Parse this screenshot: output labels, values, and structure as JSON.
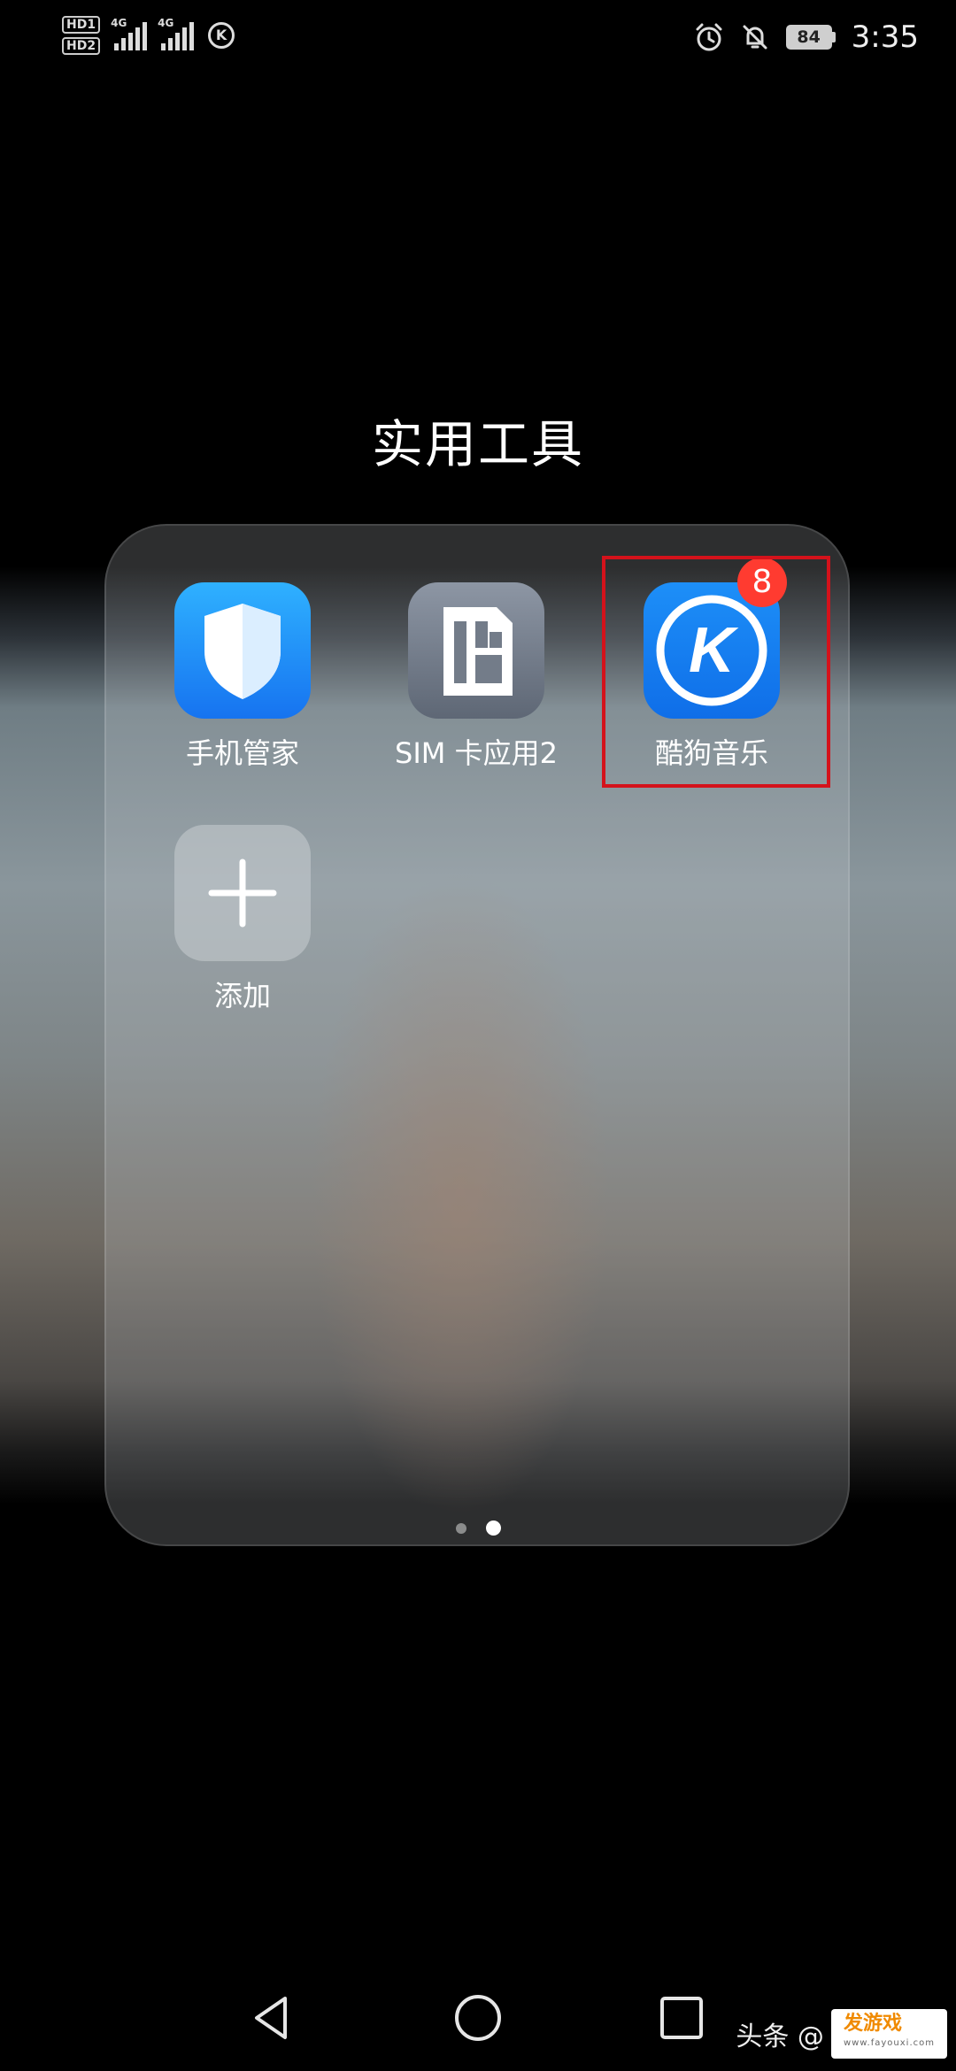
{
  "status_bar": {
    "sim1_label": "HD1",
    "sim2_label": "HD2",
    "network1": "4G",
    "network2": "4G",
    "kugou_status_icon": "K",
    "battery_level": "84",
    "time": "3:35"
  },
  "folder": {
    "title": "实用工具",
    "apps": [
      {
        "label": "手机管家",
        "icon": "shield-icon"
      },
      {
        "label": "SIM 卡应用2",
        "icon": "sim-card-icon"
      },
      {
        "label": "酷狗音乐",
        "icon": "kugou-icon",
        "badge": "8"
      }
    ],
    "add": {
      "label": "添加",
      "icon": "plus-icon"
    },
    "pages": 2,
    "current_page": 2
  },
  "watermark": {
    "text": "头条 @",
    "logo_main": "发游戏",
    "logo_sub": "www.fayouxi.com"
  },
  "colors": {
    "badge": "#ff3b30",
    "highlight_box": "#d4121b",
    "kugou_blue": "#1d8ff8"
  }
}
